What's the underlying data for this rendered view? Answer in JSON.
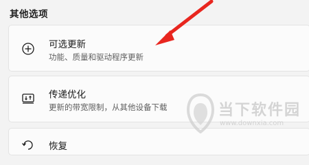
{
  "section": {
    "title": "其他选项"
  },
  "items": [
    {
      "icon": "plus-circle-icon",
      "title": "可选更新",
      "description": "功能、质量和驱动程序更新"
    },
    {
      "icon": "delivery-optimization-icon",
      "title": "传递优化",
      "description": "更新的带宽限制，从其他设备下载"
    },
    {
      "icon": "recovery-icon",
      "title": "恢复",
      "description": ""
    }
  ],
  "watermark": {
    "text": "当下软件园",
    "url": "www.downxia.com"
  },
  "colors": {
    "annotation_arrow": "#e8261f",
    "background": "#f3f3f3",
    "card": "#fbfbfb"
  }
}
